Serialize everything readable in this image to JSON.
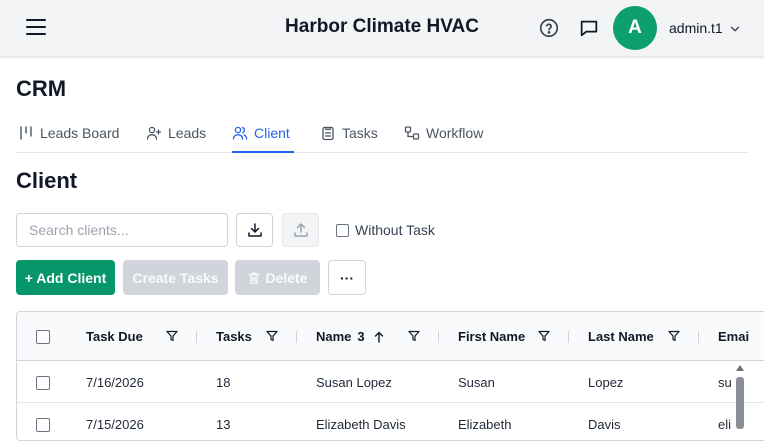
{
  "header": {
    "app_title": "Harbor Climate HVAC",
    "avatar_letter": "A",
    "username": "admin.t1",
    "avatar_color": "#0e9f6e"
  },
  "page": {
    "title": "CRM",
    "section_title": "Client"
  },
  "tabs": [
    {
      "label": "Leads Board",
      "icon": "kanban-icon"
    },
    {
      "label": "Leads",
      "icon": "user-plus-icon"
    },
    {
      "label": "Client",
      "icon": "users-icon",
      "active": true
    },
    {
      "label": "Tasks",
      "icon": "clipboard-icon"
    },
    {
      "label": "Workflow",
      "icon": "workflow-icon"
    }
  ],
  "toolbar": {
    "search_placeholder": "Search clients...",
    "without_task_label": "Without Task",
    "add_client_label": "+ Add Client",
    "create_tasks_label": "Create Tasks",
    "delete_label": "Delete",
    "more_label": "···"
  },
  "table": {
    "columns": [
      "Task Due",
      "Tasks",
      "Name",
      "First Name",
      "Last Name",
      "Emai"
    ],
    "name_sort_count": "3",
    "rows": [
      {
        "task_due": "7/16/2026",
        "tasks": "18",
        "name": "Susan Lopez",
        "first_name": "Susan",
        "last_name": "Lopez",
        "email": "su"
      },
      {
        "task_due": "7/15/2026",
        "tasks": "13",
        "name": "Elizabeth Davis",
        "first_name": "Elizabeth",
        "last_name": "Davis",
        "email": "eli"
      }
    ]
  },
  "colors": {
    "accent": "#2563eb",
    "primary_button": "#059669",
    "disabled_button": "#d1d5db"
  }
}
